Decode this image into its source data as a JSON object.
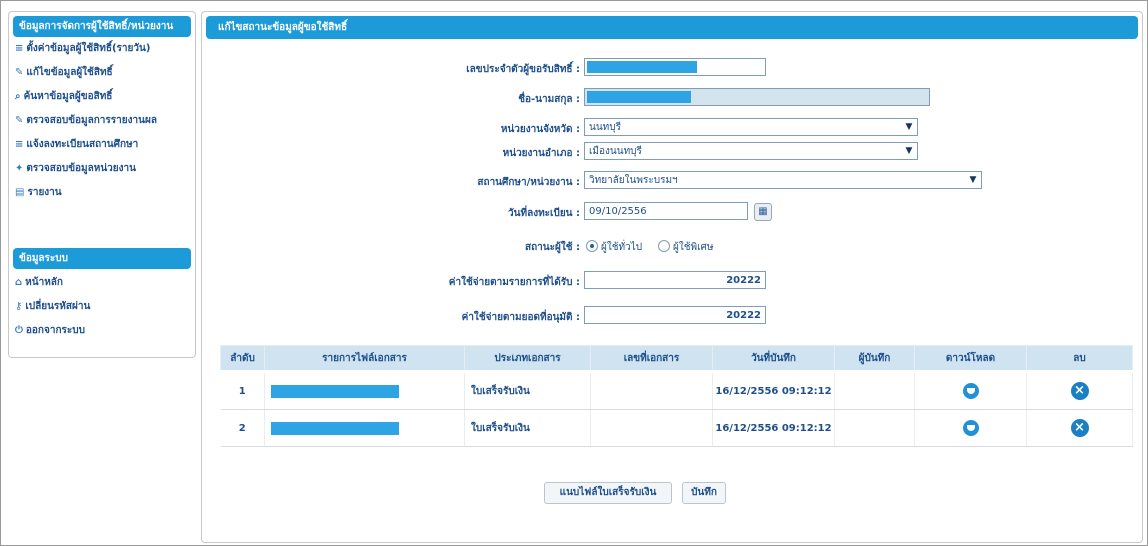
{
  "sidebar": {
    "header_top": "ข้อมูลการจัดการผู้ใช้สิทธิ์/หน่วยงาน",
    "items_top": [
      {
        "icon": "document-icon",
        "glyph": "≡",
        "label": "ตั้งค่าข้อมูลผู้ใช้สิทธิ์(รายวัน)"
      },
      {
        "icon": "edit-icon",
        "glyph": "✎",
        "label": "แก้ไขข้อมูลผู้ใช้สิทธิ์"
      },
      {
        "icon": "search-icon",
        "glyph": "⌕",
        "label": "ค้นหาข้อมูลผู้ขอสิทธิ์"
      },
      {
        "icon": "edit-icon",
        "glyph": "✎",
        "label": "ตรวจสอบข้อมูลการรายงานผล"
      },
      {
        "icon": "document-icon",
        "glyph": "≡",
        "label": "แจ้งลงทะเบียนสถานศึกษา"
      },
      {
        "icon": "star-icon",
        "glyph": "✦",
        "label": "ตรวจสอบข้อมูลหน่วยงาน"
      },
      {
        "icon": "report-icon",
        "glyph": "▤",
        "label": "รายงาน"
      }
    ],
    "header_mid": "ข้อมูลระบบ",
    "items_bottom": [
      {
        "icon": "home-icon",
        "glyph": "⌂",
        "label": "หน้าหลัก"
      },
      {
        "icon": "key-icon",
        "glyph": "⚷",
        "label": "เปลี่ยนรหัสผ่าน"
      },
      {
        "icon": "logout-icon",
        "glyph": "⏻",
        "label": "ออกจากระบบ"
      }
    ]
  },
  "main": {
    "title": "แก้ไขสถานะข้อมูลผู้ขอใช้สิทธิ์",
    "form": {
      "id_label": "เลขประจำตัวผู้ขอรับสิทธิ์ :",
      "name_label": "ชื่อ-นามสกุล :",
      "province_label": "หน่วยงานจังหวัด :",
      "province_value": "นนทบุรี",
      "district_label": "หน่วยงานอำเภอ :",
      "district_value": "เมืองนนทบุรี",
      "school_label": "สถานศึกษา/หน่วยงาน :",
      "school_value": "วิทยาลัยในพระบรมฯ",
      "date_label": "วันที่ลงทะเบียน :",
      "date_value": "09/10/2556",
      "calendar_icon": "calendar-icon",
      "status_label": "สถานะผู้ใช้ :",
      "status_options": [
        "ผู้ใช้ทั่วไป",
        "ผู้ใช้พิเศษ"
      ],
      "status_selected": 0,
      "amount1_label": "ค่าใช้จ่ายตามรายการที่ได้รับ :",
      "amount1_value": "20222",
      "amount2_label": "ค่าใช้จ่ายตามยอดที่อนุมัติ :",
      "amount2_value": "20222"
    },
    "table": {
      "headers": [
        "ลำดับ",
        "รายการไฟล์เอกสาร",
        "ประเภทเอกสาร",
        "เลขที่เอกสาร",
        "วันที่บันทึก",
        "ผู้บันทึก",
        "ดาวน์โหลด",
        "ลบ"
      ],
      "rows": [
        {
          "no": "1",
          "type": "ใบเสร็จรับเงิน",
          "number": "",
          "date": "16/12/2556 09:12:12",
          "by": "",
          "download_icon": "download-icon",
          "delete_icon": "delete-icon"
        },
        {
          "no": "2",
          "type": "ใบเสร็จรับเงิน",
          "number": "",
          "date": "16/12/2556 09:12:12",
          "by": "",
          "download_icon": "download-icon",
          "delete_icon": "delete-icon"
        }
      ]
    },
    "buttons": {
      "upload": "แนบไฟล์ใบเสร็จรับเงิน",
      "save": "บันทึก"
    }
  },
  "colors": {
    "accent": "#1d9ad8",
    "header_row": "#cfe3f1",
    "text": "#1f4f8a"
  }
}
